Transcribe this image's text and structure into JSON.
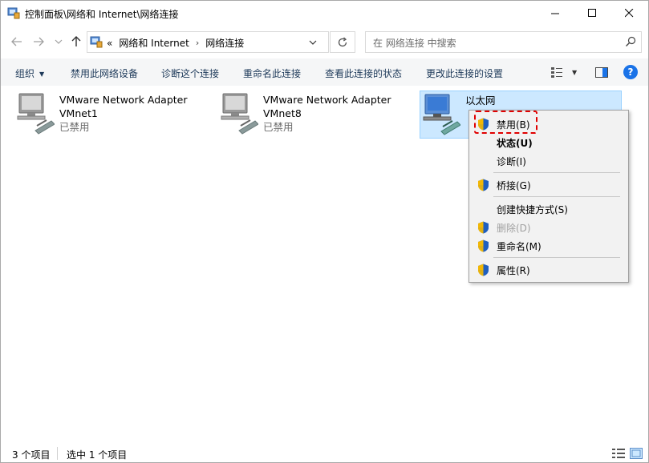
{
  "window": {
    "title": "控制面板\\网络和 Internet\\网络连接",
    "controls": [
      "minimize",
      "maximize",
      "close"
    ]
  },
  "address_bar": {
    "prefix": "«",
    "breadcrumbs": [
      "网络和 Internet",
      "网络连接"
    ],
    "separator": "›",
    "search_placeholder": "在 网络连接 中搜索"
  },
  "command_bar": {
    "organize": "组织",
    "items": [
      "禁用此网络设备",
      "诊断这个连接",
      "重命名此连接",
      "查看此连接的状态",
      "更改此连接的设置"
    ]
  },
  "connections": [
    {
      "name": "VMware Network Adapter",
      "sub": "VMnet1",
      "status": "已禁用",
      "selected": false
    },
    {
      "name": "VMware Network Adapter",
      "sub": "VMnet8",
      "status": "已禁用",
      "selected": false
    },
    {
      "name": "以太网",
      "sub": "",
      "status": "",
      "selected": true
    }
  ],
  "context_menu": {
    "items": [
      {
        "label": "禁用(B)",
        "shield": true,
        "bold": false,
        "disabled": false,
        "highlighted": true
      },
      {
        "label": "状态(U)",
        "shield": false,
        "bold": true,
        "disabled": false
      },
      {
        "label": "诊断(I)",
        "shield": false,
        "bold": false,
        "disabled": false
      },
      {
        "label": "桥接(G)",
        "shield": true,
        "bold": false,
        "disabled": false
      },
      {
        "label": "创建快捷方式(S)",
        "shield": false,
        "bold": false,
        "disabled": false
      },
      {
        "label": "删除(D)",
        "shield": true,
        "bold": false,
        "disabled": true
      },
      {
        "label": "重命名(M)",
        "shield": true,
        "bold": false,
        "disabled": false
      },
      {
        "label": "属性(R)",
        "shield": true,
        "bold": false,
        "disabled": false
      }
    ]
  },
  "status_bar": {
    "item_count": "3 个项目",
    "selected": "选中 1 个项目"
  },
  "colors": {
    "selection_bg": "#cce8ff",
    "selection_border": "#99d1ff",
    "highlight_dash": "#e00000",
    "help_blue": "#1a73e8",
    "shield_blue": "#1f5fbf",
    "shield_gold": "#f2b705"
  }
}
